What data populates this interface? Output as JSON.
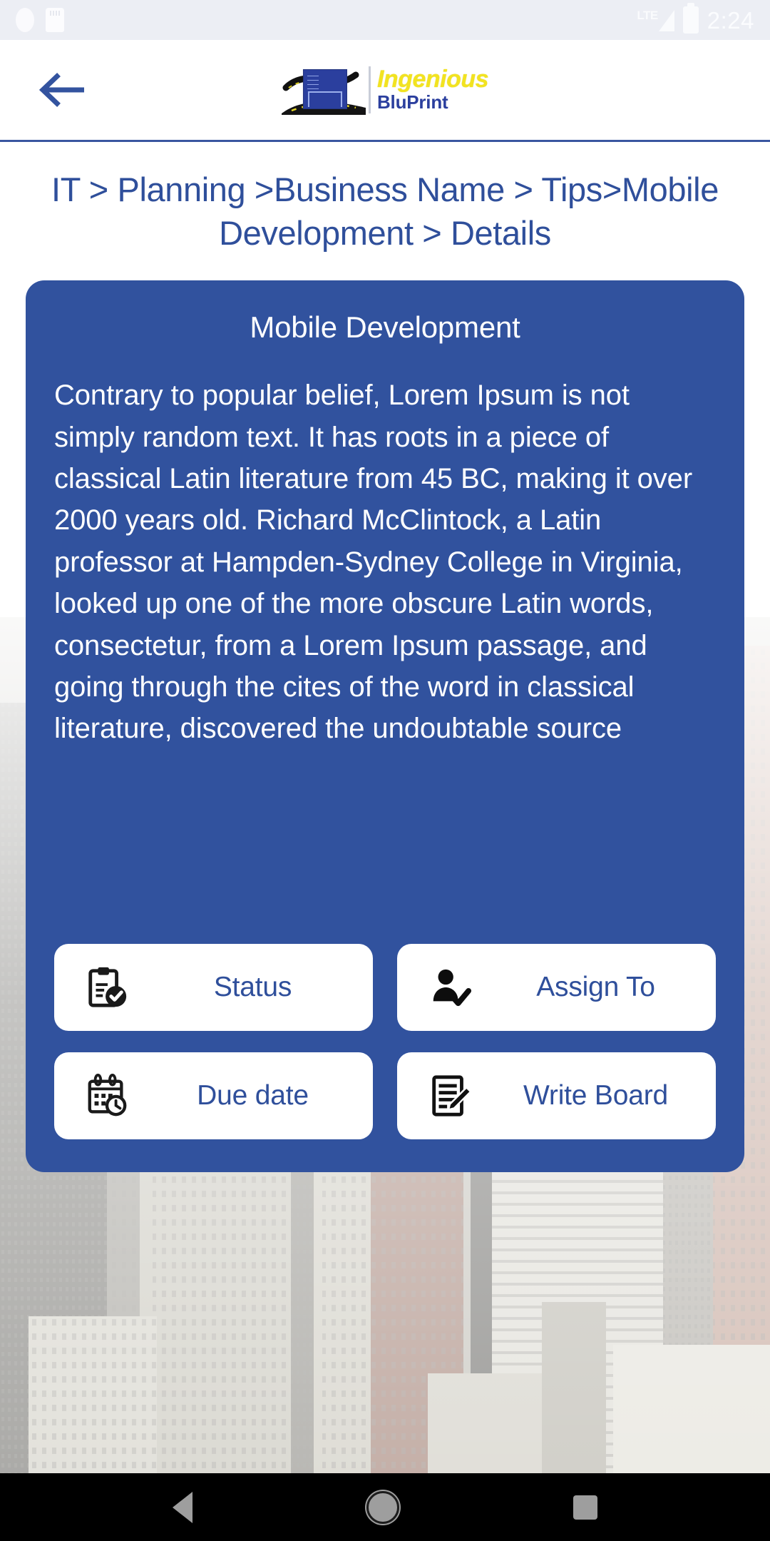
{
  "statusbar": {
    "time": "2:24",
    "network_label": "LTE",
    "icons": [
      "battery-saver-icon",
      "sim-card-icon",
      "lte-signal-icon",
      "battery-icon"
    ]
  },
  "appbar": {
    "back_icon": "back-arrow-icon",
    "logo": {
      "primary_text": "Ingenious",
      "secondary_text": "BluPrint",
      "primary_color": "#f2e320",
      "secondary_color": "#2b3f9e"
    }
  },
  "breadcrumb": {
    "text": "IT > Planning >Business Name > Tips>Mobile Development > Details"
  },
  "card": {
    "title": "Mobile Development",
    "body": "Contrary to popular belief, Lorem Ipsum is not simply random text. It has roots in a piece of classical Latin literature from 45 BC, making it over 2000 years old. Richard McClintock, a Latin professor at Hampden-Sydney College in Virginia, looked up one of the more obscure Latin words, consectetur, from a Lorem Ipsum passage, and going through the cites of the word in classical literature, discovered the undoubtable source",
    "background_color": "#31529e",
    "actions": [
      {
        "label": "Status",
        "icon": "clipboard-check-icon"
      },
      {
        "label": "Assign To",
        "icon": "person-check-icon"
      },
      {
        "label": "Due date",
        "icon": "calendar-clock-icon"
      },
      {
        "label": "Write Board",
        "icon": "document-pencil-icon"
      }
    ]
  },
  "navbar": {
    "back": "nav-back-icon",
    "home": "nav-home-icon",
    "recents": "nav-recents-icon"
  },
  "colors": {
    "accent_blue": "#2f4f9b",
    "card_blue": "#31529e",
    "status_bar_bg": "#eceef4",
    "nav_bar_bg": "#000000"
  }
}
